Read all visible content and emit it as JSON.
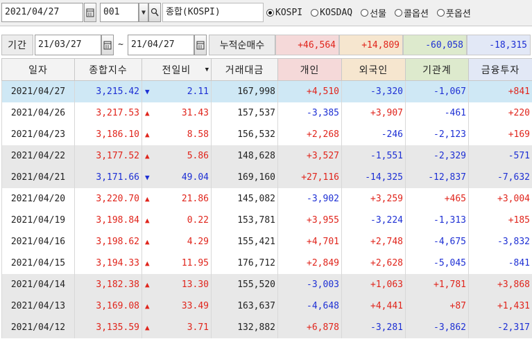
{
  "toolbar": {
    "date": "2021/04/27",
    "code": "001",
    "market_name": "종합(KOSPI)",
    "radios": [
      {
        "label": "KOSPI",
        "checked": true
      },
      {
        "label": "KOSDAQ",
        "checked": false
      },
      {
        "label": "선물",
        "checked": false
      },
      {
        "label": "콜옵션",
        "checked": false
      },
      {
        "label": "풋옵션",
        "checked": false
      }
    ]
  },
  "period": {
    "label": "기간",
    "from": "21/03/27",
    "tilde": "~",
    "to": "21/04/27",
    "cumulative_label": "누적순매수",
    "sums": {
      "individual": "+46,564",
      "foreign": "+14,809",
      "institution": "-60,058",
      "financial": "-18,315"
    }
  },
  "table": {
    "headers": [
      "일자",
      "종합지수",
      "전일비",
      "거래대금",
      "개인",
      "외국인",
      "기관계",
      "금융투자"
    ],
    "rows": [
      {
        "date": "2021/04/27",
        "index": "3,215.42",
        "dir": "down",
        "change": "2.11",
        "volume": "167,998",
        "individual": "+4,510",
        "foreign": "-3,320",
        "institution": "-1,067",
        "financial": "+841"
      },
      {
        "date": "2021/04/26",
        "index": "3,217.53",
        "dir": "up",
        "change": "31.43",
        "volume": "157,537",
        "individual": "-3,385",
        "foreign": "+3,907",
        "institution": "-461",
        "financial": "+220"
      },
      {
        "date": "2021/04/23",
        "index": "3,186.10",
        "dir": "up",
        "change": "8.58",
        "volume": "156,532",
        "individual": "+2,268",
        "foreign": "-246",
        "institution": "-2,123",
        "financial": "+169"
      },
      {
        "date": "2021/04/22",
        "index": "3,177.52",
        "dir": "up",
        "change": "5.86",
        "volume": "148,628",
        "individual": "+3,527",
        "foreign": "-1,551",
        "institution": "-2,329",
        "financial": "-571"
      },
      {
        "date": "2021/04/21",
        "index": "3,171.66",
        "dir": "down",
        "change": "49.04",
        "volume": "169,160",
        "individual": "+27,116",
        "foreign": "-14,325",
        "institution": "-12,837",
        "financial": "-7,632"
      },
      {
        "date": "2021/04/20",
        "index": "3,220.70",
        "dir": "up",
        "change": "21.86",
        "volume": "145,082",
        "individual": "-3,902",
        "foreign": "+3,259",
        "institution": "+465",
        "financial": "+3,004"
      },
      {
        "date": "2021/04/19",
        "index": "3,198.84",
        "dir": "up",
        "change": "0.22",
        "volume": "153,781",
        "individual": "+3,955",
        "foreign": "-3,224",
        "institution": "-1,313",
        "financial": "+185"
      },
      {
        "date": "2021/04/16",
        "index": "3,198.62",
        "dir": "up",
        "change": "4.29",
        "volume": "155,421",
        "individual": "+4,701",
        "foreign": "+2,748",
        "institution": "-4,675",
        "financial": "-3,832"
      },
      {
        "date": "2021/04/15",
        "index": "3,194.33",
        "dir": "up",
        "change": "11.95",
        "volume": "176,712",
        "individual": "+2,849",
        "foreign": "+2,628",
        "institution": "-5,045",
        "financial": "-841"
      },
      {
        "date": "2021/04/14",
        "index": "3,182.38",
        "dir": "up",
        "change": "13.30",
        "volume": "155,520",
        "individual": "-3,003",
        "foreign": "+1,063",
        "institution": "+1,781",
        "financial": "+3,868"
      },
      {
        "date": "2021/04/13",
        "index": "3,169.08",
        "dir": "up",
        "change": "33.49",
        "volume": "163,637",
        "individual": "-4,648",
        "foreign": "+4,441",
        "institution": "+87",
        "financial": "+1,431"
      },
      {
        "date": "2021/04/12",
        "index": "3,135.59",
        "dir": "up",
        "change": "3.71",
        "volume": "132,882",
        "individual": "+6,878",
        "foreign": "-3,281",
        "institution": "-3,862",
        "financial": "-2,317"
      }
    ]
  },
  "colors": {
    "up": "#e0241b",
    "down": "#1d2fd4",
    "selected_row": "#cfe8f5",
    "shaded_row": "#e8e8e8"
  }
}
